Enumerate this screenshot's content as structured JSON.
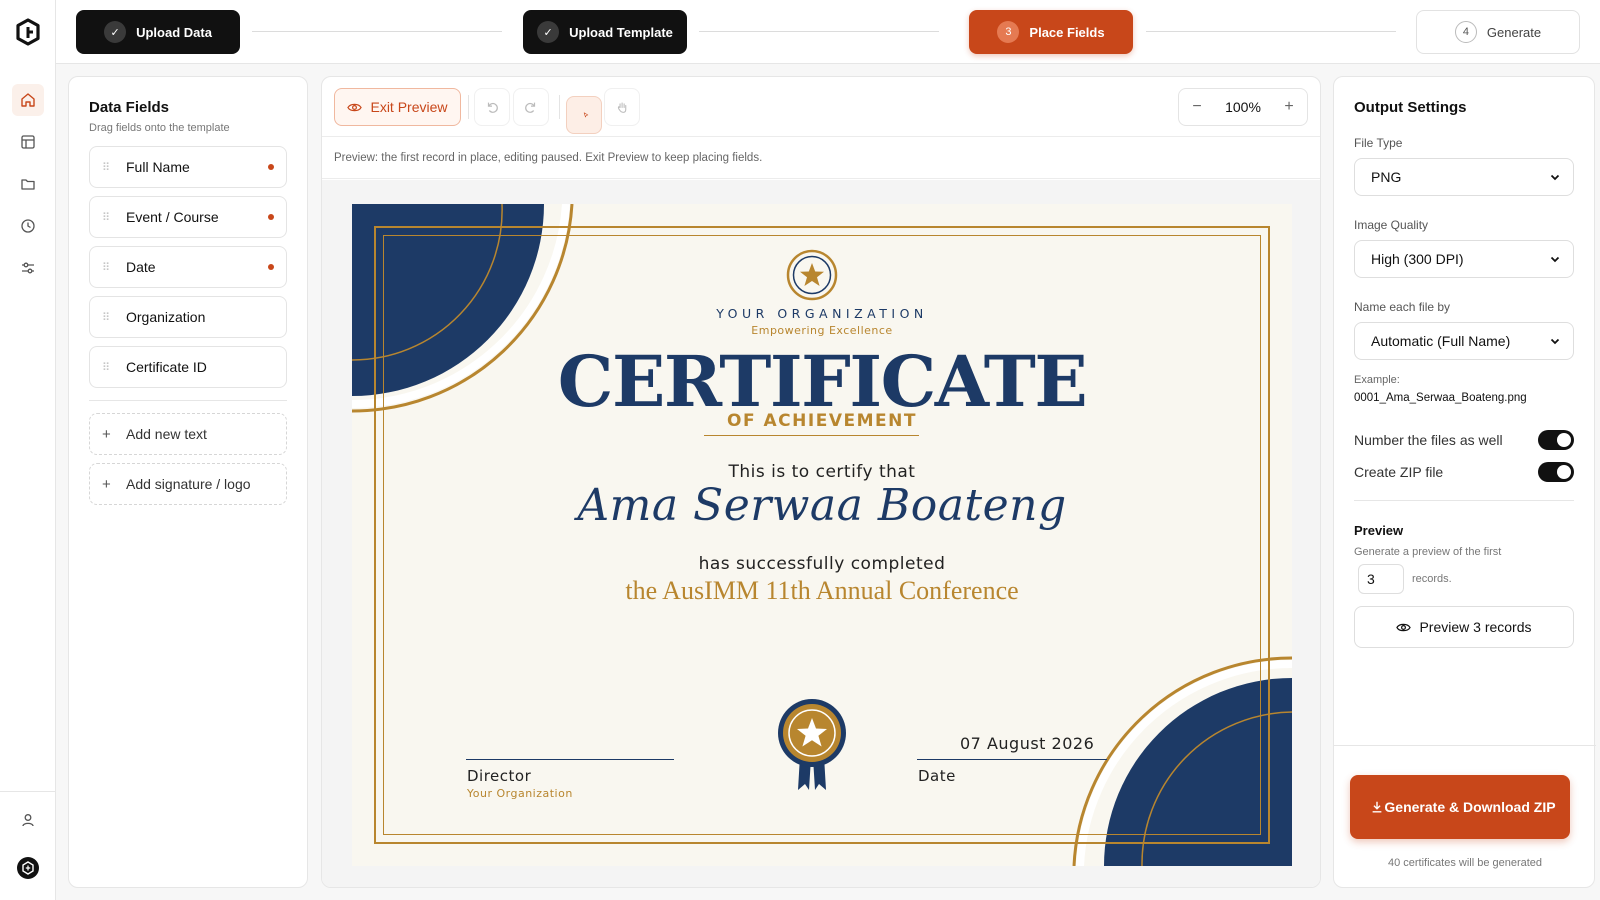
{
  "steps": [
    {
      "num": "✓",
      "label": "Upload Data",
      "state": "done"
    },
    {
      "num": "✓",
      "label": "Upload Template",
      "state": "done"
    },
    {
      "num": "3",
      "label": "Place Fields",
      "state": "active"
    },
    {
      "num": "4",
      "label": "Generate",
      "state": "pending"
    }
  ],
  "left": {
    "title": "Data Fields",
    "subtitle": "Drag fields onto the template",
    "fields": [
      "Full Name",
      "Event / Course",
      "Date",
      "Organization",
      "Certificate ID"
    ],
    "add_text": "Add new text",
    "add_signature": "Add signature / logo"
  },
  "toolbar": {
    "exit_preview": "Exit Preview",
    "zoom": "100%",
    "zoom_out": "−",
    "zoom_in": "+"
  },
  "notice": "Preview: the first record in place, editing paused. Exit Preview to keep placing fields.",
  "certificate": {
    "org": "YOUR ORGANIZATION",
    "tagline": "Empowering Excellence",
    "title": "CERTIFICATE",
    "subtitle": "OF ACHIEVEMENT",
    "certify": "This is to certify that",
    "name": "Ama Serwaa Boateng",
    "completed": "has successfully completed",
    "event": "the AusIMM 11th Annual Conference",
    "date": "07 August 2026",
    "director_label": "Director",
    "director_org": "Your Organization",
    "date_label": "Date",
    "colors": {
      "navy": "#1d3a66",
      "gold": "#b8862f"
    }
  },
  "output": {
    "title": "Output Settings",
    "file_type_label": "File Type",
    "file_type": "PNG",
    "quality_label": "Image Quality",
    "quality": "High (300 DPI)",
    "naming_label": "Name each file by",
    "naming": "Automatic (Full Name)",
    "example_label": "Example:",
    "example": "0001_Ama_Serwaa_Boateng.png",
    "number_files": "Number the files as well",
    "create_zip": "Create ZIP file",
    "number_files_on": true,
    "create_zip_on": true,
    "preview_title": "Preview",
    "preview_desc": "Generate a preview of the first",
    "preview_count": "3",
    "preview_suffix": "records.",
    "preview_button": "Preview 3 records",
    "generate_button": "Generate & Download ZIP",
    "generate_footer": "40 certificates will be generated"
  },
  "colors": {
    "accent": "#c8471a",
    "dark": "#111111"
  }
}
